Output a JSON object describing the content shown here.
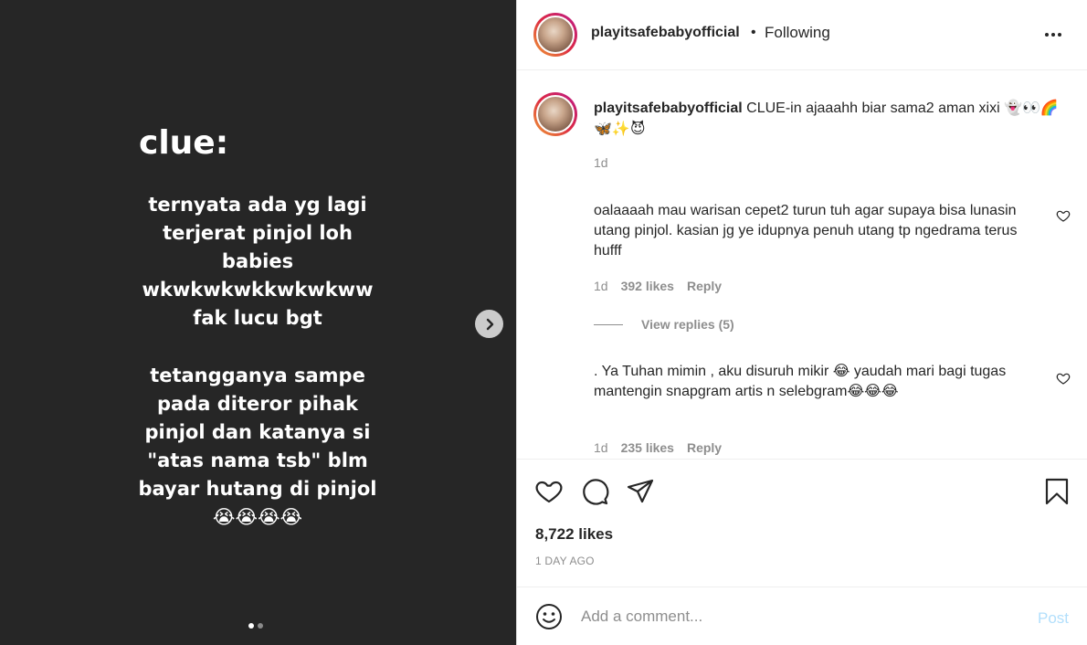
{
  "media": {
    "title": "clue:",
    "paragraph_1": "ternyata ada yg lagi\nterjerat pinjol loh\nbabies\nwkwkwkwkkwkwkww\nfak lucu bgt",
    "paragraph_2": "tetangganya sampe\npada diteror pihak\npinjol dan katanya si\n\"atas nama tsb\" blm\nbayar hutang di pinjol\n😭😭😭😭",
    "slide_count": 2,
    "active_slide": 1
  },
  "header": {
    "username": "playitsafebabyofficial",
    "separator": "•",
    "follow_status": "Following"
  },
  "caption": {
    "username": "playitsafebabyofficial",
    "text": "CLUE-in ajaaahh biar sama2 aman xixi 👻👀🌈🦋✨😈",
    "time": "1d"
  },
  "comments": [
    {
      "text": "oalaaaah mau warisan cepet2 turun tuh agar supaya bisa lunasin utang pinjol. kasian jg ye idupnya penuh utang tp ngedrama terus hufff",
      "time": "1d",
      "likes": "392 likes",
      "reply_label": "Reply",
      "view_replies": "View replies (5)"
    },
    {
      "text": ". Ya Tuhan mimin , aku disuruh mikir 😂 yaudah mari bagi tugas mantengin snapgram artis n selebgram😂😂😂",
      "time": "1d",
      "likes": "235 likes",
      "reply_label": "Reply"
    }
  ],
  "post": {
    "likes": "8,722 likes",
    "date": "1 DAY AGO"
  },
  "composer": {
    "placeholder": "Add a comment...",
    "post_label": "Post"
  }
}
